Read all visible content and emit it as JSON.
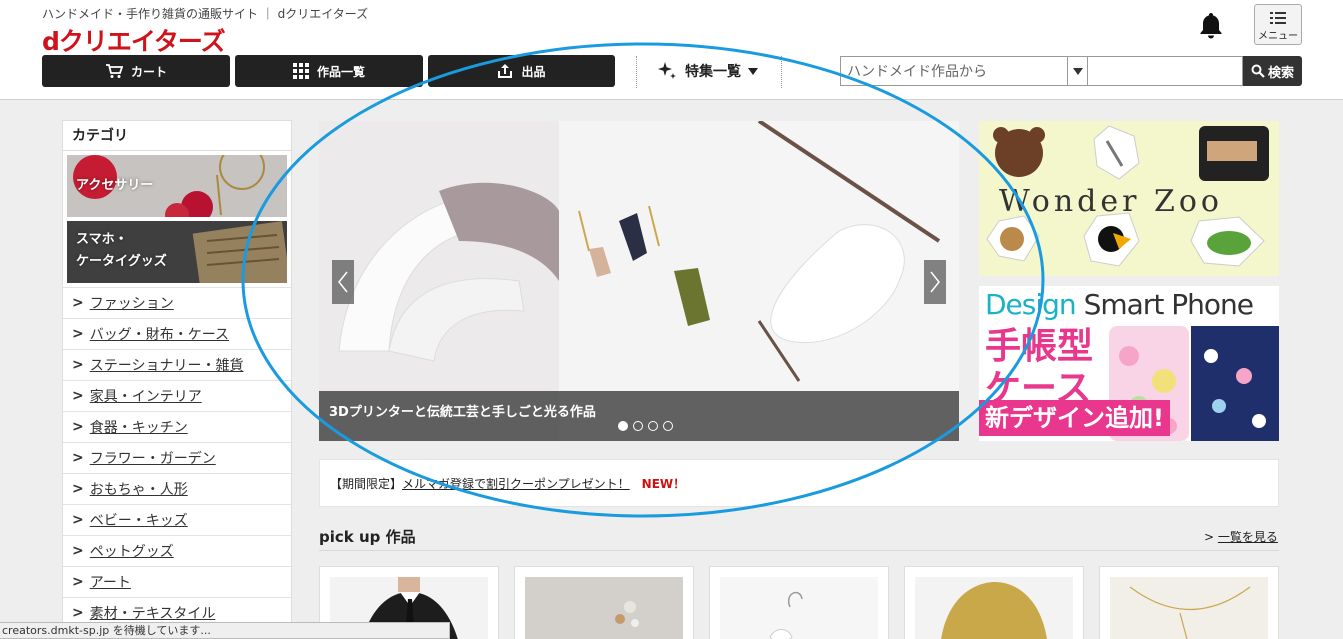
{
  "header": {
    "tagline": "ハンドメイド・手作り雑貨の通販サイト ｜ dクリエイターズ",
    "logo": "dクリエイターズ",
    "menu_label": "メニュー",
    "nav": {
      "cart": "カート",
      "works": "作品一覧",
      "exhibit": "出品",
      "features": "特集一覧"
    },
    "search": {
      "scope": "ハンドメイド作品から",
      "query": "",
      "button": "検索"
    }
  },
  "sidebar": {
    "title": "カテゴリ",
    "banners": [
      {
        "label": "アクセサリー"
      },
      {
        "label": "スマホ・",
        "label2": "ケータイグッズ"
      }
    ],
    "items": [
      "ファッション",
      "バッグ・財布・ケース",
      "ステーショナリー・雑貨",
      "家具・インテリア",
      "食器・キッチン",
      "フラワー・ガーデン",
      "おもちゃ・人形",
      "ベビー・キッズ",
      "ペットグッズ",
      "アート",
      "素材・テキスタイル"
    ]
  },
  "slider": {
    "caption": "3Dプリンターと伝統工芸と手しごと光る作品",
    "slide_count": 4,
    "active_slide": 1
  },
  "side_banners": {
    "zoo": "Wonder Zoo",
    "phone_design": "Design",
    "phone_smart": "Smart Phone",
    "phone_line1": "手帳型",
    "phone_line2": "ケース",
    "phone_new": "新デザイン追加!"
  },
  "notice": {
    "prefix": "【期間限定】",
    "link": "メルマガ登録で割引クーポンプレゼント！",
    "badge": "NEW！"
  },
  "pickup": {
    "title": "pick up 作品",
    "see_all": "一覧を見る"
  },
  "status_bar": "creators.dmkt-sp.jp を待機しています...",
  "colors": {
    "brand_red": "#d0121b",
    "annotation_blue": "#1a9be0",
    "nav_dark": "#222222"
  }
}
